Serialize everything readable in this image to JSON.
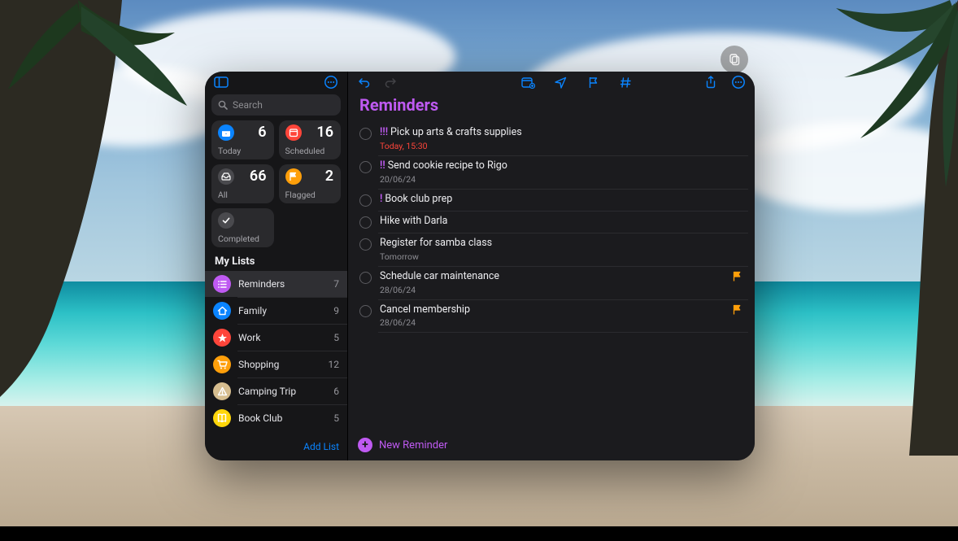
{
  "search": {
    "placeholder": "Search"
  },
  "smart": {
    "today": {
      "label": "Today",
      "count": "6"
    },
    "scheduled": {
      "label": "Scheduled",
      "count": "16"
    },
    "all": {
      "label": "All",
      "count": "66"
    },
    "flagged": {
      "label": "Flagged",
      "count": "2"
    },
    "completed": {
      "label": "Completed"
    }
  },
  "mylists_header": "My Lists",
  "lists": [
    {
      "name": "Reminders",
      "count": "7",
      "color": "#bf5af2",
      "icon": "list"
    },
    {
      "name": "Family",
      "count": "9",
      "color": "#0a84ff",
      "icon": "home"
    },
    {
      "name": "Work",
      "count": "5",
      "color": "#ff453a",
      "icon": "star"
    },
    {
      "name": "Shopping",
      "count": "12",
      "color": "#ff9f0a",
      "icon": "cart"
    },
    {
      "name": "Camping Trip",
      "count": "6",
      "color": "#d6bd8f",
      "icon": "tent"
    },
    {
      "name": "Book Club",
      "count": "5",
      "color": "#ffd60a",
      "icon": "book"
    }
  ],
  "sidebar_footer": "Add List",
  "main_title": "Reminders",
  "reminders": [
    {
      "priority": "!!!",
      "title": "Pick up arts & crafts supplies",
      "sub": "Today, 15:30",
      "overdue": true,
      "flagged": false
    },
    {
      "priority": "!!",
      "title": "Send cookie recipe to Rigo",
      "sub": "20/06/24",
      "overdue": false,
      "flagged": false
    },
    {
      "priority": "!",
      "title": "Book club prep",
      "sub": "",
      "overdue": false,
      "flagged": false
    },
    {
      "priority": "",
      "title": "Hike with Darla",
      "sub": "",
      "overdue": false,
      "flagged": false
    },
    {
      "priority": "",
      "title": "Register for samba class",
      "sub": "Tomorrow",
      "overdue": false,
      "flagged": false
    },
    {
      "priority": "",
      "title": "Schedule car maintenance",
      "sub": "28/06/24",
      "overdue": false,
      "flagged": true
    },
    {
      "priority": "",
      "title": "Cancel membership",
      "sub": "28/06/24",
      "overdue": false,
      "flagged": true
    }
  ],
  "new_reminder_label": "New Reminder"
}
